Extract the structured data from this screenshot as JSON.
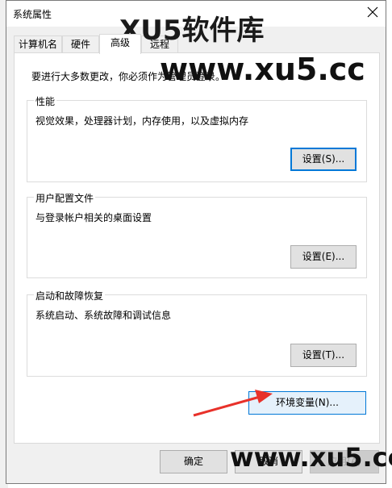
{
  "window": {
    "title": "系统属性"
  },
  "tabs": [
    {
      "label": "计算机名"
    },
    {
      "label": "硬件"
    },
    {
      "label": "高级"
    },
    {
      "label": "远程"
    }
  ],
  "advanced": {
    "intro": "要进行大多数更改，你必须作为管理员登录。",
    "performance": {
      "title": "性能",
      "description": "视觉效果，处理器计划，内存使用，以及虚拟内存",
      "button": "设置(S)..."
    },
    "user_profiles": {
      "title": "用户配置文件",
      "description": "与登录帐户相关的桌面设置",
      "button": "设置(E)..."
    },
    "startup_recovery": {
      "title": "启动和故障恢复",
      "description": "系统启动、系统故障和调试信息",
      "button": "设置(T)..."
    },
    "env_button": "环境变量(N)..."
  },
  "footer": {
    "ok": "确定",
    "cancel": "取消",
    "apply": "应用(A)"
  },
  "watermark": {
    "top": "XU5软件库",
    "url": "www.xu5.cc",
    "bottom_url": "www.xu5.cc"
  },
  "annotation": {
    "arrow_color": "#e8312a"
  },
  "icons": {
    "close": "close-icon"
  }
}
